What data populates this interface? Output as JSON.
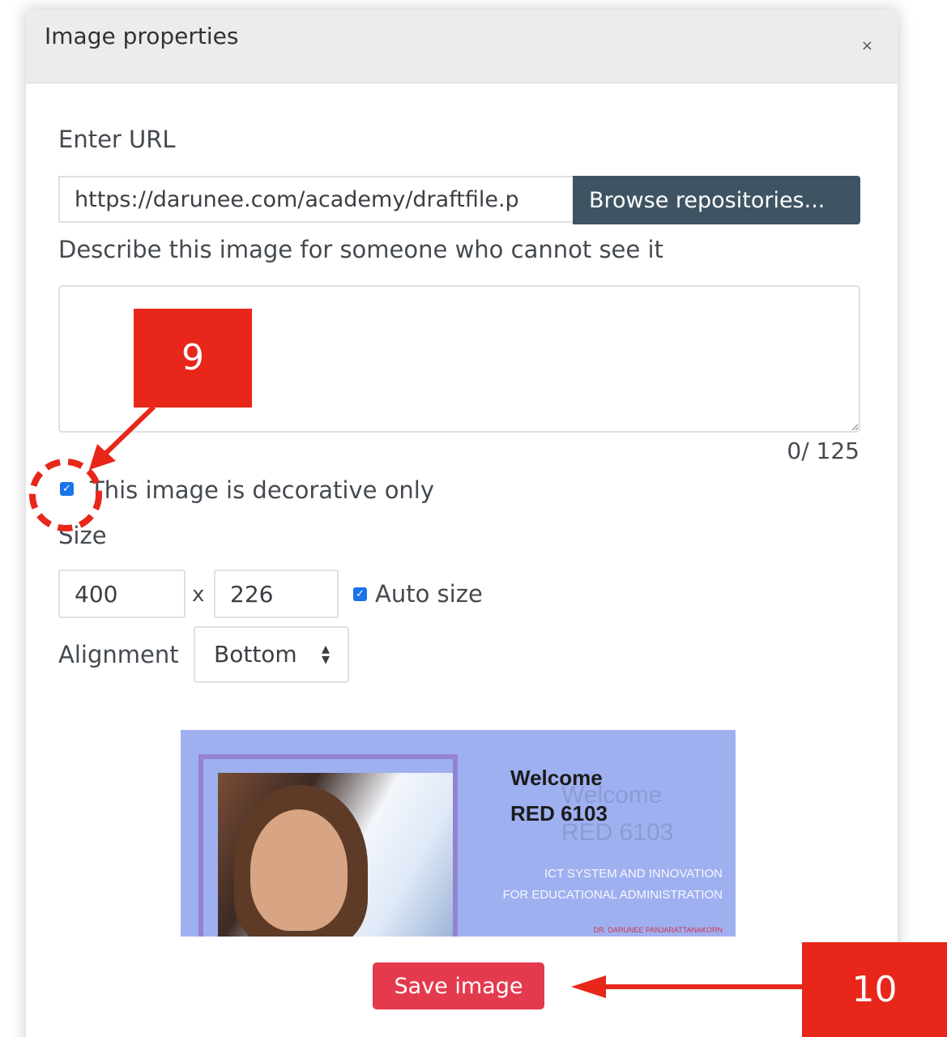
{
  "dialog": {
    "title": "Image properties",
    "close_label": "×",
    "url_label": "Enter URL",
    "url_value": "https://darunee.com/academy/draftfile.p",
    "browse_label": "Browse repositories...",
    "describe_label": "Describe this image for someone who cannot see it",
    "description_value": "",
    "char_counter": "0/ 125",
    "decorative_label": "This image is decorative only",
    "decorative_checked": true,
    "size_label": "Size",
    "width": "400",
    "times": "x",
    "height": "226",
    "auto_size_label": "Auto size",
    "auto_size_checked": true,
    "alignment_label": "Alignment",
    "alignment_value": "Bottom",
    "save_label": "Save image"
  },
  "preview": {
    "line1": "Welcome",
    "line2": "RED 6103",
    "subtitle1": "ICT SYSTEM AND INNOVATION",
    "subtitle2": "FOR EDUCATIONAL ADMINISTRATION",
    "author": "DR. DARUNEE PANJARATTANAKORN"
  },
  "annotations": {
    "marker_9": "9",
    "marker_10": "10"
  },
  "colors": {
    "accent_save": "#e43a4e",
    "browse_bg": "#3f5463",
    "annotation_red": "#e8261a",
    "checkbox_blue": "#1a73e8"
  }
}
